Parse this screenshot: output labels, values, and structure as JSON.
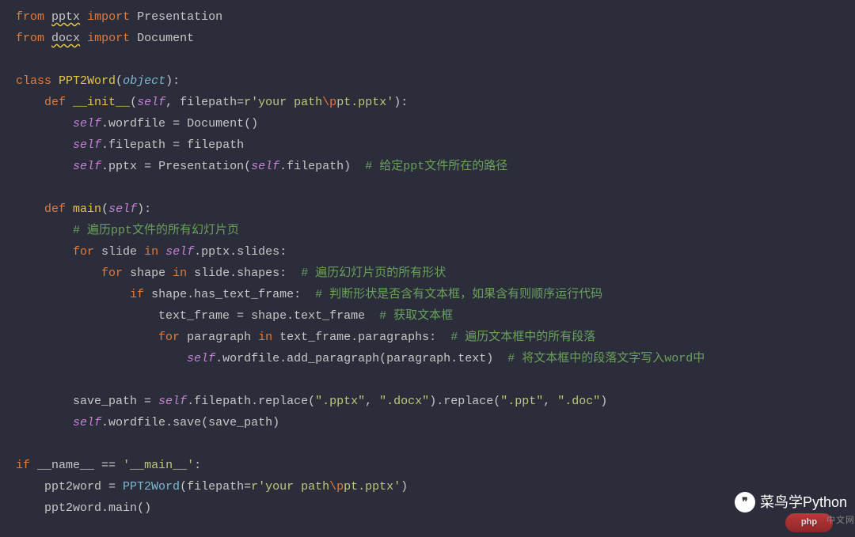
{
  "code": {
    "line1_from": "from",
    "line1_module": "pptx",
    "line1_import": "import",
    "line1_name": "Presentation",
    "line2_from": "from",
    "line2_module": "docx",
    "line2_import": "import",
    "line2_name": "Document",
    "line4_class": "class",
    "line4_name": "PPT2Word",
    "line4_base": "object",
    "line5_def": "def",
    "line5_fn": "__init__",
    "line5_self": "self",
    "line5_param": "filepath",
    "line5_eq": "=",
    "line5_r": "r",
    "line5_str": "'your path",
    "line5_esc": "\\p",
    "line5_str2": "pt.pptx'",
    "line6_self": "self",
    "line6_attr": "wordfile",
    "line6_eq": " = ",
    "line6_call": "Document",
    "line7_self": "self",
    "line7_attr": "filepath",
    "line7_eq": " = ",
    "line7_val": "filepath",
    "line8_self": "self",
    "line8_attr": "pptx",
    "line8_eq": " = ",
    "line8_call": "Presentation",
    "line8_arg_self": "self",
    "line8_arg_attr": "filepath",
    "line8_comment": "# 给定ppt文件所在的路径",
    "line10_def": "def",
    "line10_fn": "main",
    "line10_self": "self",
    "line11_comment": "# 遍历ppt文件的所有幻灯片页",
    "line12_for": "for",
    "line12_var": "slide",
    "line12_in": "in",
    "line12_self": "self",
    "line12_attr1": "pptx",
    "line12_attr2": "slides",
    "line13_for": "for",
    "line13_var": "shape",
    "line13_in": "in",
    "line13_obj": "slide",
    "line13_attr": "shapes",
    "line13_comment": "# 遍历幻灯片页的所有形状",
    "line14_if": "if",
    "line14_obj": "shape",
    "line14_attr": "has_text_frame",
    "line14_comment": "# 判断形状是否含有文本框，如果含有则顺序运行代码",
    "line15_var": "text_frame",
    "line15_eq": " = ",
    "line15_obj": "shape",
    "line15_attr": "text_frame",
    "line15_comment": "# 获取文本框",
    "line16_for": "for",
    "line16_var": "paragraph",
    "line16_in": "in",
    "line16_obj": "text_frame",
    "line16_attr": "paragraphs",
    "line16_comment": "# 遍历文本框中的所有段落",
    "line17_self": "self",
    "line17_attr1": "wordfile",
    "line17_fn": "add_paragraph",
    "line17_arg_obj": "paragraph",
    "line17_arg_attr": "text",
    "line17_comment": "# 将文本框中的段落文字写入word中",
    "line19_var": "save_path",
    "line19_eq": " = ",
    "line19_self": "self",
    "line19_attr": "filepath",
    "line19_fn": "replace",
    "line19_str1": "\".pptx\"",
    "line19_str2": "\".docx\"",
    "line19_fn2": "replace",
    "line19_str3": "\".ppt\"",
    "line19_str4": "\".doc\"",
    "line20_self": "self",
    "line20_attr": "wordfile",
    "line20_fn": "save",
    "line20_arg": "save_path",
    "line22_if": "if",
    "line22_name": "__name__",
    "line22_eq": " == ",
    "line22_str": "'__main__'",
    "line23_var": "ppt2word",
    "line23_eq": " = ",
    "line23_cls": "PPT2Word",
    "line23_param": "filepath",
    "line23_peq": "=",
    "line23_r": "r",
    "line23_str": "'your path",
    "line23_esc": "\\p",
    "line23_str2": "pt.pptx'",
    "line24_obj": "ppt2word",
    "line24_fn": "main"
  },
  "watermark": {
    "text": "菜鸟学Python",
    "icon": "❞"
  },
  "badge": {
    "php": "php",
    "cn": "中文网"
  }
}
